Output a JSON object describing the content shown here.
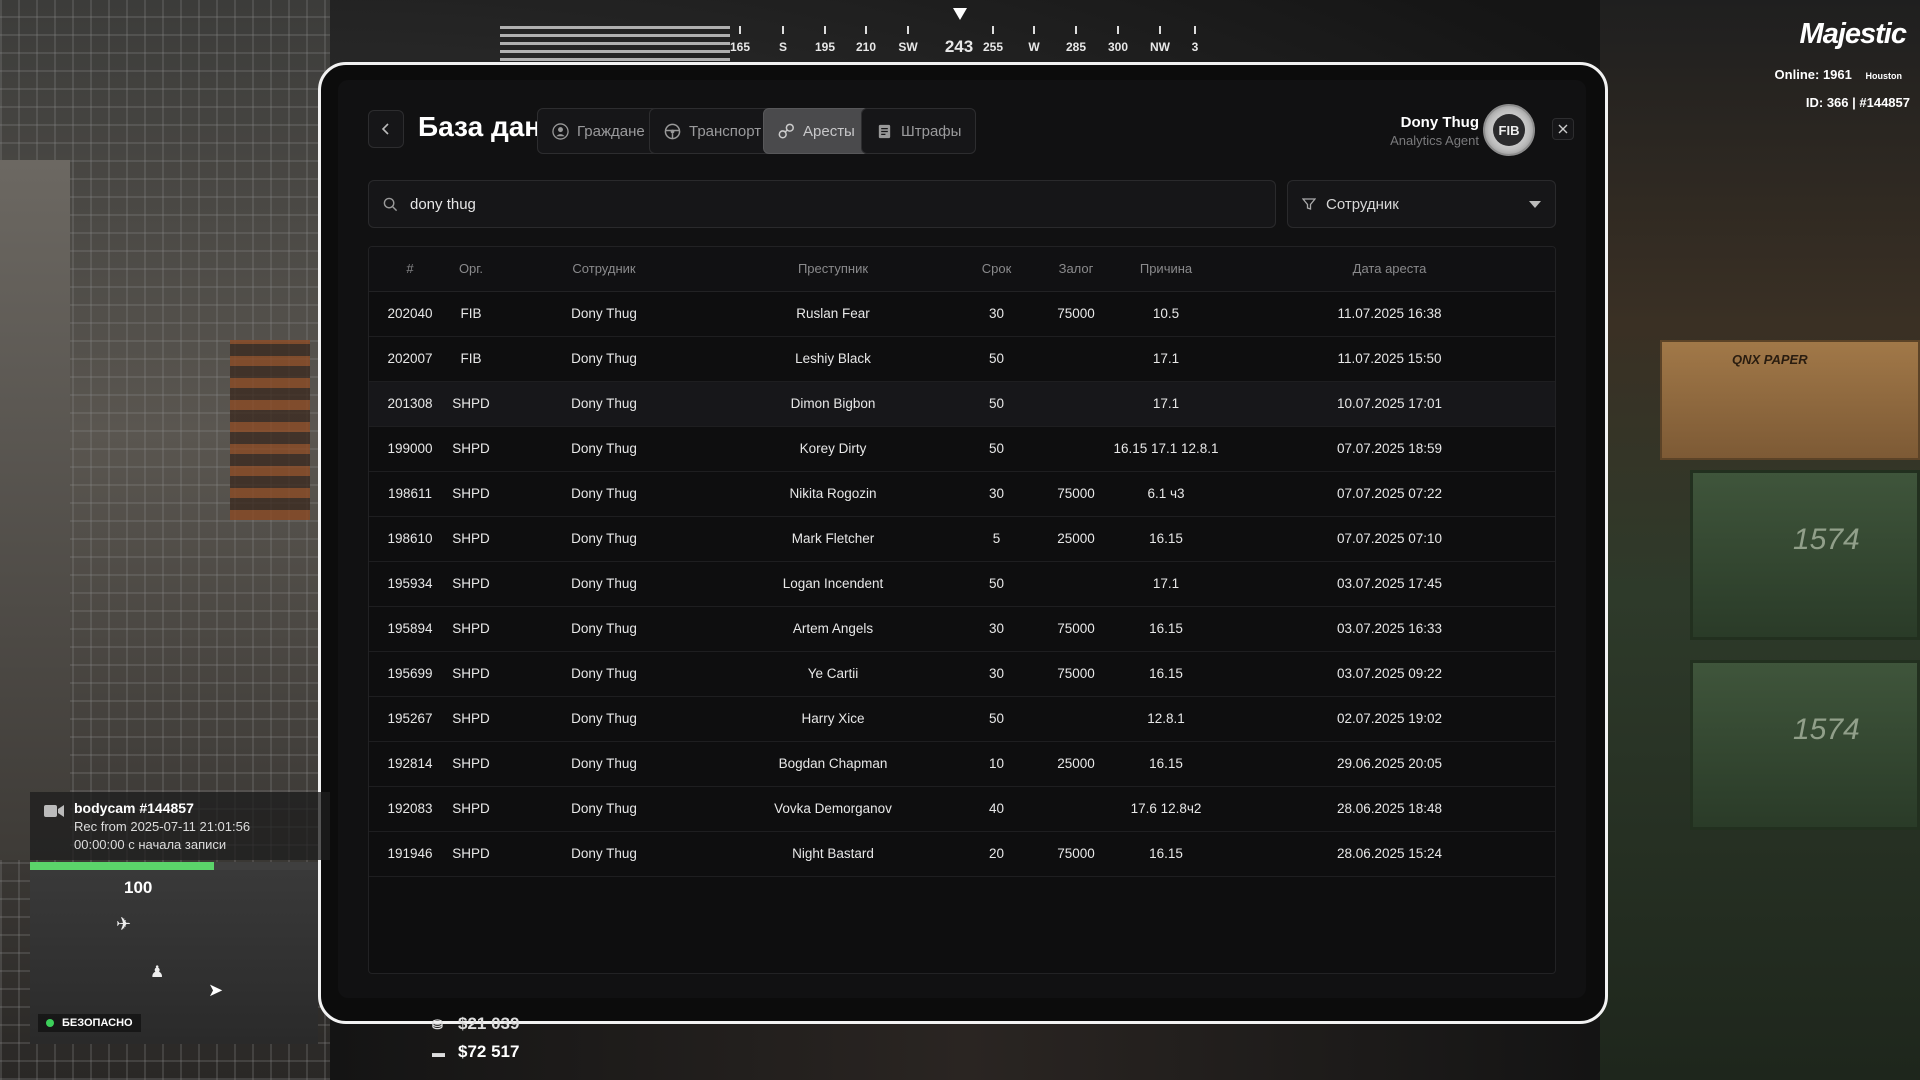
{
  "compass": {
    "heading": "243",
    "marks": [
      {
        "label": "165",
        "pos": 740
      },
      {
        "label": "S",
        "pos": 783
      },
      {
        "label": "195",
        "pos": 825
      },
      {
        "label": "210",
        "pos": 866
      },
      {
        "label": "SW",
        "pos": 908
      },
      {
        "label": "255",
        "pos": 993
      },
      {
        "label": "W",
        "pos": 1034
      },
      {
        "label": "285",
        "pos": 1076
      },
      {
        "label": "300",
        "pos": 1118
      },
      {
        "label": "NW",
        "pos": 1160
      },
      {
        "label": "3",
        "pos": 1195
      }
    ]
  },
  "brand": {
    "name": "Majestic"
  },
  "server": {
    "online_label": "Online:",
    "online_count": "1961",
    "name": "Houston",
    "id_text": "ID: 366 | ",
    "id_num": "#144857"
  },
  "header": {
    "title": "База данных",
    "tabs": [
      {
        "label": "Граждане",
        "icon": "person-icon",
        "active": false
      },
      {
        "label": "Транспорт",
        "icon": "steering-wheel-icon",
        "active": false
      },
      {
        "label": "Аресты",
        "icon": "handcuffs-icon",
        "active": true
      },
      {
        "label": "Штрафы",
        "icon": "document-icon",
        "active": false
      }
    ],
    "user_name": "Dony Thug",
    "user_role": "Analytics Agent",
    "badge_text": "FIB"
  },
  "search": {
    "value": "dony thug",
    "placeholder": ""
  },
  "filter": {
    "label": "Сотрудник"
  },
  "table": {
    "columns": [
      "#",
      "Орг.",
      "Сотрудник",
      "Преступник",
      "Срок",
      "Залог",
      "Причина",
      "Дата ареста"
    ],
    "rows": [
      [
        "202040",
        "FIB",
        "Dony Thug",
        "Ruslan Fear",
        "30",
        "75000",
        "10.5",
        "11.07.2025 16:38"
      ],
      [
        "202007",
        "FIB",
        "Dony Thug",
        "Leshiy Black",
        "50",
        "",
        "17.1",
        "11.07.2025 15:50"
      ],
      [
        "201308",
        "SHPD",
        "Dony Thug",
        "Dimon Bigbon",
        "50",
        "",
        "17.1",
        "10.07.2025 17:01"
      ],
      [
        "199000",
        "SHPD",
        "Dony Thug",
        "Korey Dirty",
        "50",
        "",
        "16.15 17.1 12.8.1",
        "07.07.2025 18:59"
      ],
      [
        "198611",
        "SHPD",
        "Dony Thug",
        "Nikita Rogozin",
        "30",
        "75000",
        "6.1 ч3",
        "07.07.2025 07:22"
      ],
      [
        "198610",
        "SHPD",
        "Dony Thug",
        "Mark Fletcher",
        "5",
        "25000",
        "16.15",
        "07.07.2025 07:10"
      ],
      [
        "195934",
        "SHPD",
        "Dony Thug",
        "Logan Incendent",
        "50",
        "",
        "17.1",
        "03.07.2025 17:45"
      ],
      [
        "195894",
        "SHPD",
        "Dony Thug",
        "Artem Angels",
        "30",
        "75000",
        "16.15",
        "03.07.2025 16:33"
      ],
      [
        "195699",
        "SHPD",
        "Dony Thug",
        "Ye Cartii",
        "30",
        "75000",
        "16.15",
        "03.07.2025 09:22"
      ],
      [
        "195267",
        "SHPD",
        "Dony Thug",
        "Harry Xice",
        "50",
        "",
        "12.8.1",
        "02.07.2025 19:02"
      ],
      [
        "192814",
        "SHPD",
        "Dony Thug",
        "Bogdan Chapman",
        "10",
        "25000",
        "16.15",
        "29.06.2025 20:05"
      ],
      [
        "192083",
        "SHPD",
        "Dony Thug",
        "Vovka Demorganov",
        "40",
        "",
        "17.6 12.8ч2",
        "28.06.2025 18:48"
      ],
      [
        "191946",
        "SHPD",
        "Dony Thug",
        "Night Bastard",
        "20",
        "75000",
        "16.15",
        "28.06.2025 15:24"
      ]
    ],
    "highlighted_row": 2
  },
  "bodycam": {
    "title": "bodycam #144857",
    "rec": "Rec from 2025-07-11 21:01:56",
    "elapsed": "00:00:00 с начала записи"
  },
  "hud": {
    "health": "100",
    "health_fraction": 0.64,
    "zone_status": "БЕЗОПАСНО",
    "cash": "$21 039",
    "bank": "$72 517"
  },
  "scene": {
    "box_label": "QNX PAPER",
    "crate_mark_1": "1574",
    "crate_mark_2": "1574"
  },
  "colors": {
    "accent_green": "#5bd36a",
    "brand_red": "#ff2b4e",
    "active_tab": "#4a4a4c"
  }
}
